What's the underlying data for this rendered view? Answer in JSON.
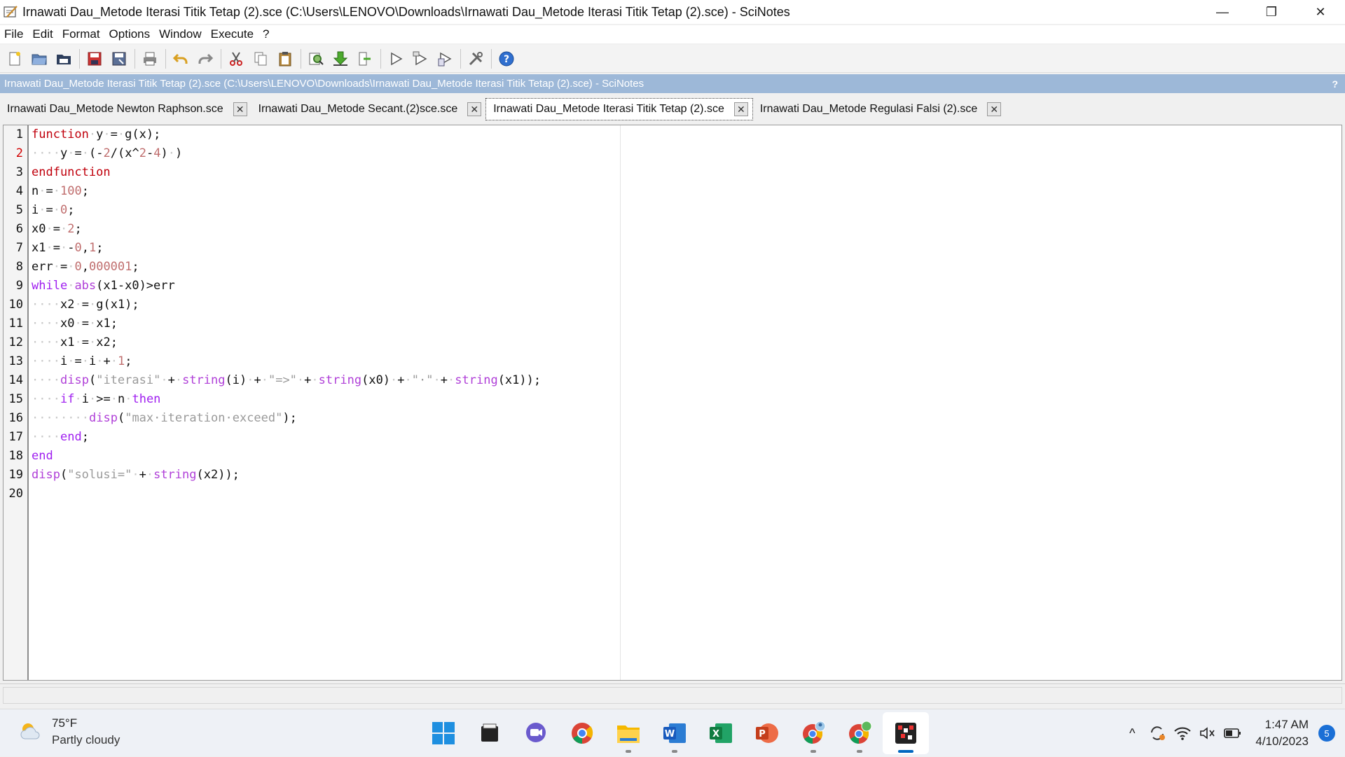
{
  "window": {
    "title": "Irnawati Dau_Metode Iterasi Titik Tetap (2).sce (C:\\Users\\LENOVO\\Downloads\\Irnawati Dau_Metode Iterasi Titik Tetap (2).sce) - SciNotes",
    "minimize": "—",
    "restore": "❐",
    "close": "✕"
  },
  "menu": [
    "File",
    "Edit",
    "Format",
    "Options",
    "Window",
    "Execute",
    "?"
  ],
  "doc_header": {
    "title": "Irnawati Dau_Metode Iterasi Titik Tetap (2).sce (C:\\Users\\LENOVO\\Downloads\\Irnawati Dau_Metode Iterasi Titik Tetap (2).sce) - SciNotes",
    "help": "?"
  },
  "tabs": [
    {
      "label": "Irnawati Dau_Metode Newton Raphson.sce",
      "active": false
    },
    {
      "label": "Irnawati Dau_Metode Secant.(2)sce.sce",
      "active": false
    },
    {
      "label": "Irnawati Dau_Metode Iterasi Titik Tetap (2).sce",
      "active": true
    },
    {
      "label": "Irnawati Dau_Metode Regulasi Falsi (2).sce",
      "active": false
    }
  ],
  "tab_close_glyph": "✕",
  "editor": {
    "current_line": 2,
    "line_numbers": [
      "1",
      "2",
      "3",
      "4",
      "5",
      "6",
      "7",
      "8",
      "9",
      "10",
      "11",
      "12",
      "13",
      "14",
      "15",
      "16",
      "17",
      "18",
      "19",
      "20"
    ],
    "lines": [
      "function y = g(x);",
      "    y = (-2/(x^2-4) )",
      "endfunction",
      "n = 100;",
      "i = 0;",
      "x0 = 2;",
      "x1 = -0,1;",
      "err = 0,000001;",
      "while abs(x1-x0)>err",
      "    x2 = g(x1);",
      "    x0 = x1;",
      "    x1 = x2;",
      "    i = i + 1;",
      "    disp(\"iterasi\" + string(i) + \"=>\" + string(x0) + \" \" + string(x1));",
      "    if i >= n then",
      "        disp(\"max iteration exceed\");",
      "    end;",
      "end",
      "disp(\"solusi=\" + string(x2));",
      ""
    ]
  },
  "taskbar": {
    "weather_temp": "75°F",
    "weather_desc": "Partly cloudy",
    "apps": [
      "windows-start",
      "file-manager",
      "teams-chat",
      "chrome",
      "file-explorer",
      "word",
      "excel",
      "powerpoint",
      "chrome-profile",
      "chrome-profile-2",
      "scilab"
    ],
    "time": "1:47 AM",
    "date": "4/10/2023",
    "notifications": "5",
    "tray_chevron": "^",
    "mute_glyph": "🔇"
  },
  "colors": {
    "keyword": "#c0000c",
    "control": "#a020f0",
    "function": "#b040d8",
    "number": "#c06e6e",
    "string": "#9a9a9a",
    "header_blue": "#9db8d8"
  }
}
